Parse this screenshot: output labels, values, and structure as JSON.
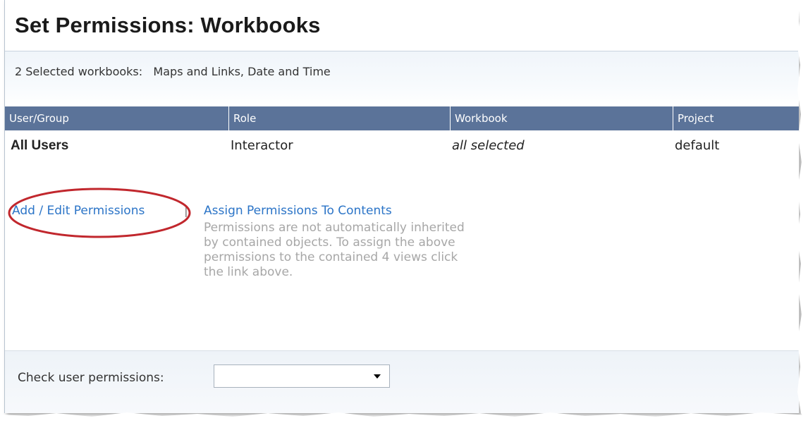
{
  "header": {
    "title": "Set Permissions: Workbooks"
  },
  "selection": {
    "label": "2 Selected workbooks:",
    "items": "Maps and Links, Date and Time"
  },
  "grid": {
    "columns": [
      "User/Group",
      "Role",
      "Workbook",
      "Project"
    ],
    "rows": [
      {
        "user_group": "All Users",
        "role": "Interactor",
        "workbook": "all selected",
        "project": "default"
      }
    ]
  },
  "actions": {
    "add_edit": "Add / Edit Permissions",
    "separator": "|",
    "assign": "Assign Permissions To Contents",
    "help": "Permissions are not automatically inherited by contained objects. To assign the above permissions to the contained 4 views click the link above."
  },
  "check_permissions": {
    "label": "Check user permissions:",
    "selected_value": ""
  },
  "colors": {
    "header_bg": "#5b7399",
    "link": "#2b74c7",
    "highlight_oval": "#c1272d",
    "help_text": "#a7a7a7"
  },
  "icons": {
    "dropdown": "chevron-down-icon"
  }
}
